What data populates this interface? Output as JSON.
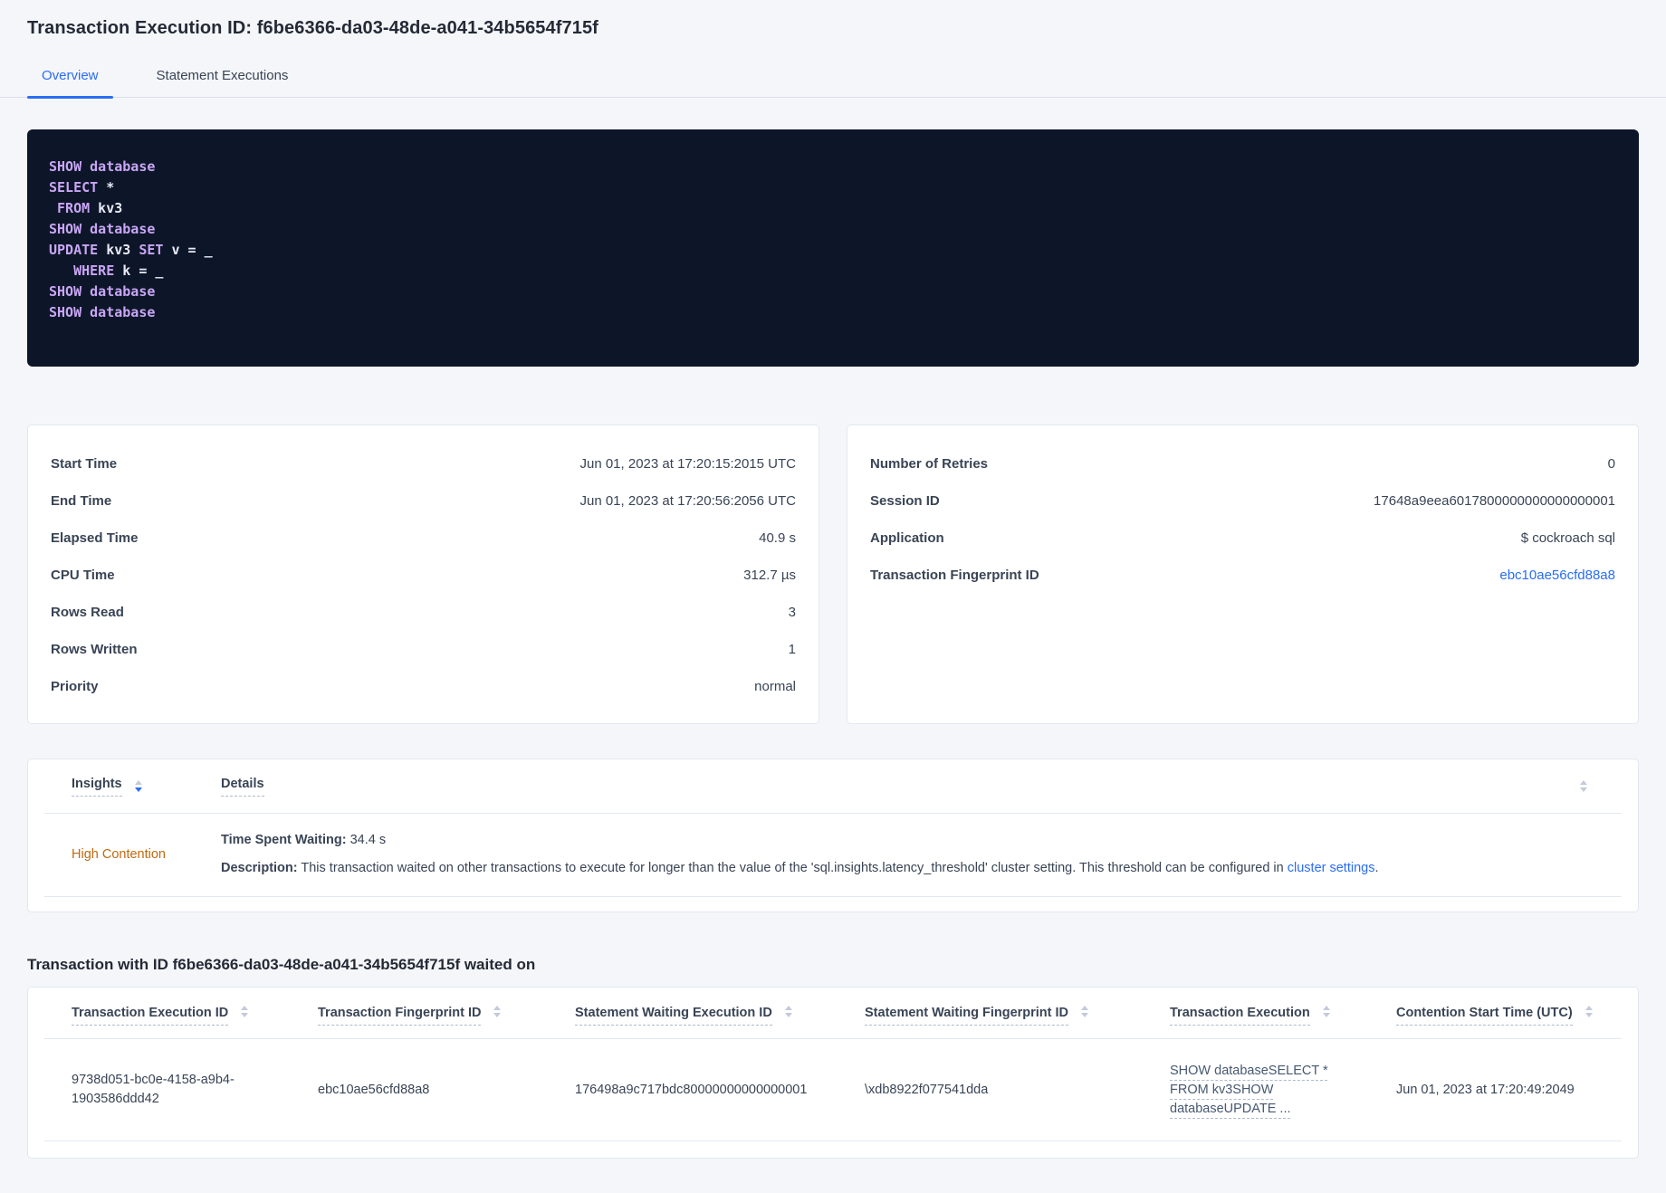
{
  "colors": {
    "accent_blue": "#2a6df4",
    "insight_orange": "#c1690f",
    "code_bg": "#0d1628",
    "code_keyword": "#c9a6f5",
    "code_text": "#e8eaf6"
  },
  "header": {
    "title": "Transaction Execution ID: f6be6366-da03-48de-a041-34b5654f715f"
  },
  "tabs": [
    {
      "label": "Overview",
      "active": true
    },
    {
      "label": "Statement Executions",
      "active": false
    }
  ],
  "sql": {
    "lines": [
      [
        [
          "kw",
          "SHOW"
        ],
        [
          "tx",
          " "
        ],
        [
          "kw",
          "database"
        ]
      ],
      [
        [
          "kw",
          "SELECT"
        ],
        [
          "tx",
          " *"
        ]
      ],
      [
        [
          "tx",
          " "
        ],
        [
          "kw",
          "FROM"
        ],
        [
          "tx",
          " kv3"
        ]
      ],
      [
        [
          "kw",
          "SHOW"
        ],
        [
          "tx",
          " "
        ],
        [
          "kw",
          "database"
        ]
      ],
      [
        [
          "kw",
          "UPDATE"
        ],
        [
          "tx",
          " kv3 "
        ],
        [
          "kw",
          "SET"
        ],
        [
          "tx",
          " v = _"
        ]
      ],
      [
        [
          "tx",
          "   "
        ],
        [
          "kw",
          "WHERE"
        ],
        [
          "tx",
          " k = _"
        ]
      ],
      [
        [
          "kw",
          "SHOW"
        ],
        [
          "tx",
          " "
        ],
        [
          "kw",
          "database"
        ]
      ],
      [
        [
          "kw",
          "SHOW"
        ],
        [
          "tx",
          " "
        ],
        [
          "kw",
          "database"
        ]
      ]
    ]
  },
  "execution_summary": {
    "rows": [
      {
        "label": "Start Time",
        "value": "Jun 01, 2023 at 17:20:15:2015 UTC"
      },
      {
        "label": "End Time",
        "value": "Jun 01, 2023 at 17:20:56:2056 UTC"
      },
      {
        "label": "Elapsed Time",
        "value": "40.9 s"
      },
      {
        "label": "CPU Time",
        "value": "312.7 µs"
      },
      {
        "label": "Rows Read",
        "value": "3"
      },
      {
        "label": "Rows Written",
        "value": "1"
      },
      {
        "label": "Priority",
        "value": "normal"
      }
    ]
  },
  "session_summary": {
    "rows": [
      {
        "label": "Number of Retries",
        "value": "0"
      },
      {
        "label": "Session ID",
        "value": "17648a9eea6017800000000000000001"
      },
      {
        "label": "Application",
        "value": "$ cockroach sql"
      },
      {
        "label": "Transaction Fingerprint ID",
        "value": "ebc10ae56cfd88a8",
        "link": true
      }
    ]
  },
  "insights": {
    "columns": [
      {
        "label": "Insights",
        "sort": "desc"
      },
      {
        "label": "Details"
      }
    ],
    "rows": [
      {
        "insight": "High Contention",
        "details": {
          "waiting_label": "Time Spent Waiting:",
          "waiting_value": "34.4 s",
          "description_label": "Description:",
          "description_text": "This transaction waited on other transactions to execute for longer than the value of the 'sql.insights.latency_threshold' cluster setting. This threshold can be configured in ",
          "description_link": "cluster settings",
          "description_suffix": "."
        }
      }
    ]
  },
  "waited_on": {
    "title": "Transaction with ID f6be6366-da03-48de-a041-34b5654f715f waited on",
    "columns": [
      "Transaction Execution ID",
      "Transaction Fingerprint ID",
      "Statement Waiting Execution ID",
      "Statement Waiting Fingerprint ID",
      "Transaction Execution",
      "Contention Start Time (UTC)"
    ],
    "rows": [
      {
        "transaction_execution_id": "9738d051-bc0e-4158-a9b4-1903586ddd42",
        "transaction_fingerprint_id": "ebc10ae56cfd88a8",
        "statement_waiting_execution_id": "176498a9c717bdc80000000000000001",
        "statement_waiting_fingerprint_id": "\\xdb8922f077541dda",
        "transaction_execution_preview": "SHOW databaseSELECT * FROM kv3SHOW databaseUPDATE ...",
        "contention_start_time": "Jun 01, 2023 at 17:20:49:2049"
      }
    ]
  }
}
